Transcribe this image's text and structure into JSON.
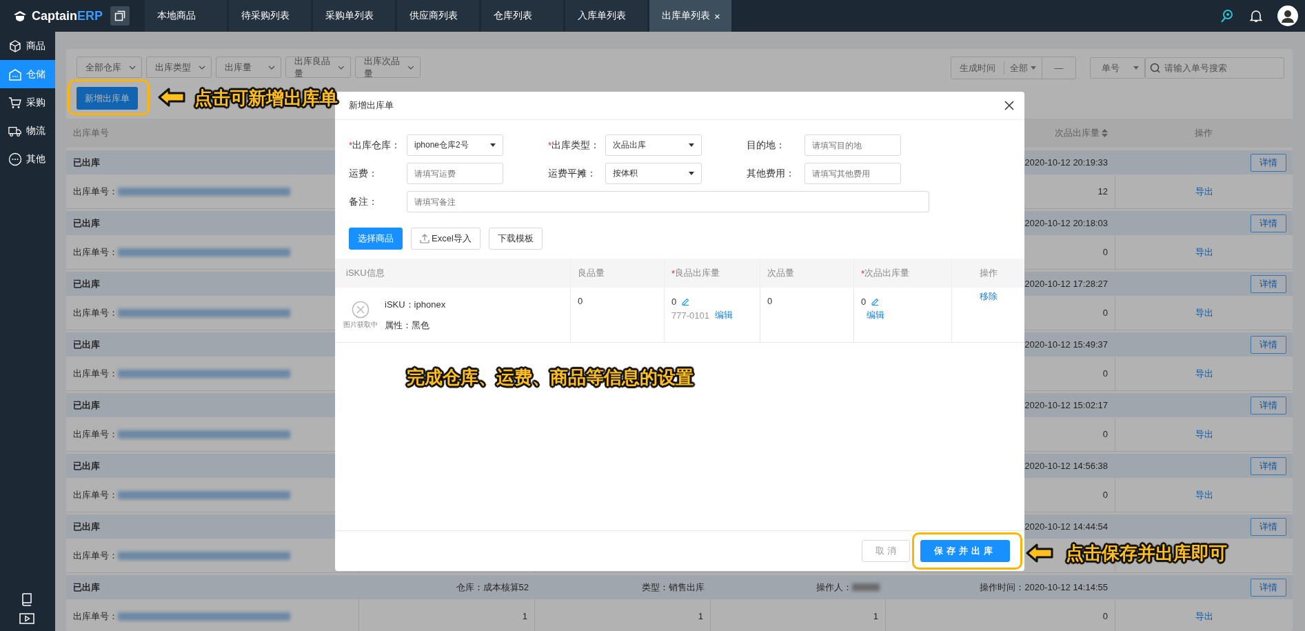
{
  "app": {
    "logo_text": "Captain",
    "logo_accent": "ERP"
  },
  "tabs": [
    {
      "label": "本地商品",
      "selected": false
    },
    {
      "label": "待采购列表",
      "selected": false
    },
    {
      "label": "采购单列表",
      "selected": false
    },
    {
      "label": "供应商列表",
      "selected": false
    },
    {
      "label": "仓库列表",
      "selected": false
    },
    {
      "label": "入库单列表",
      "selected": false
    },
    {
      "label": "出库单列表",
      "selected": true,
      "close": "×"
    }
  ],
  "sidebar": {
    "items": [
      {
        "label": "商品",
        "kind": "box",
        "selected": false
      },
      {
        "label": "仓储",
        "kind": "warehouse",
        "selected": true
      },
      {
        "label": "采购",
        "kind": "cart",
        "selected": false
      },
      {
        "label": "物流",
        "kind": "truck",
        "selected": false
      },
      {
        "label": "其他",
        "kind": "more",
        "selected": false
      }
    ]
  },
  "filters": {
    "dropdowns": [
      "全部仓库",
      "出库类型",
      "出库量",
      "出库良品量",
      "出库次品量"
    ],
    "date": {
      "label": "生成时间",
      "range": "全部",
      "separator": "—"
    },
    "search": {
      "field": "单号",
      "placeholder": "请输入单号搜索"
    }
  },
  "add_button": "新增出库单",
  "list": {
    "columns": [
      {
        "label": "出库单号"
      },
      {
        "label": "次品出库量",
        "sortable": true
      },
      {
        "label": "操作"
      }
    ],
    "groups": [
      {
        "status": "已出库",
        "order_label": "出库单号：",
        "time": "2020-10-12 20:19:33",
        "detail_button": "详情",
        "defect_qty": "12",
        "export_link": "导出"
      },
      {
        "status": "已出库",
        "order_label": "出库单号：",
        "time": "2020-10-12 20:18:03",
        "detail_button": "详情",
        "defect_qty": "0",
        "export_link": "导出"
      },
      {
        "status": "已出库",
        "order_label": "出库单号：",
        "time": "2020-10-12 17:28:27",
        "detail_button": "详情",
        "defect_qty": "0",
        "export_link": "导出"
      },
      {
        "status": "已出库",
        "order_label": "出库单号：",
        "time": "2020-10-12 15:49:37",
        "detail_button": "详情",
        "defect_qty": "0",
        "export_link": "导出"
      },
      {
        "status": "已出库",
        "order_label": "出库单号：",
        "time": "2020-10-12 15:02:17",
        "detail_button": "详情",
        "defect_qty": "0",
        "export_link": "导出"
      },
      {
        "status": "已出库",
        "order_label": "出库单号：",
        "time": "2020-10-12 14:56:38",
        "detail_button": "详情",
        "defect_qty": "0",
        "export_link": "导出"
      },
      {
        "status": "已出库",
        "order_label": "出库单号：",
        "time": "2020-10-12 14:44:54",
        "detail_button": "详情"
      },
      {
        "status": "已出库",
        "warehouse": "仓库：成本核算52",
        "type": "类型：销售出库",
        "operator_label": "操作人：",
        "time": "操作时间：2020-10-12 14:14:55",
        "detail_button": "详情",
        "order_label": "出库单号：",
        "cells": [
          "1",
          "1",
          "1"
        ],
        "defect_qty": "0",
        "export_link": "导出"
      }
    ]
  },
  "dialog": {
    "title": "新增出库单",
    "fields": [
      {
        "label": "出库仓库：",
        "required_mark": "*",
        "kind": "select",
        "value": "iphone仓库2号"
      },
      {
        "label": "出库类型：",
        "required_mark": "*",
        "kind": "select",
        "value": "次品出库"
      },
      {
        "label": "目的地：",
        "kind": "input",
        "placeholder": "请填写目的地"
      },
      {
        "label": "运费：",
        "kind": "input",
        "placeholder": "请填写运费"
      },
      {
        "label": "运费平摊：",
        "kind": "select",
        "value": "按体积"
      },
      {
        "label": "其他费用：",
        "kind": "input",
        "placeholder": "请填写其他费用"
      },
      {
        "label": "备注：",
        "kind": "wide",
        "placeholder": "请填写备注"
      }
    ],
    "actions": [
      {
        "label": "选择商品",
        "kind": "primary"
      },
      {
        "label": "Excel导入",
        "kind": "upload"
      },
      {
        "label": "下载模板",
        "kind": "plain"
      }
    ],
    "columns": [
      {
        "label": "iSKU信息"
      },
      {
        "label": "良品量"
      },
      {
        "label": "良品出库量",
        "required_mark": "*"
      },
      {
        "label": "次品量"
      },
      {
        "label": "次品出库量",
        "required_mark": "*"
      },
      {
        "label": "操作"
      }
    ],
    "rows": [
      {
        "image_text": "图片获取中",
        "sku": "iSKU：iphonex",
        "attr": "属性：黑色",
        "good_qty": "0",
        "good_out": "0",
        "good_out_code": "777-0101",
        "good_out_edit": "编辑",
        "defect_qty": "0",
        "defect_out": "0",
        "defect_out_edit": "编辑",
        "remove": "移除"
      }
    ],
    "cancel": "取 消",
    "save": "保存并出库"
  },
  "annotations": [
    {
      "text": "点击可新增出库单",
      "arrow": true,
      "highlight": true
    },
    {
      "text": "完成仓库、运费、商品等信息的设置",
      "arrow": false,
      "highlight": false
    },
    {
      "text": "点击保存并出库即可",
      "arrow": true,
      "highlight": true
    }
  ]
}
